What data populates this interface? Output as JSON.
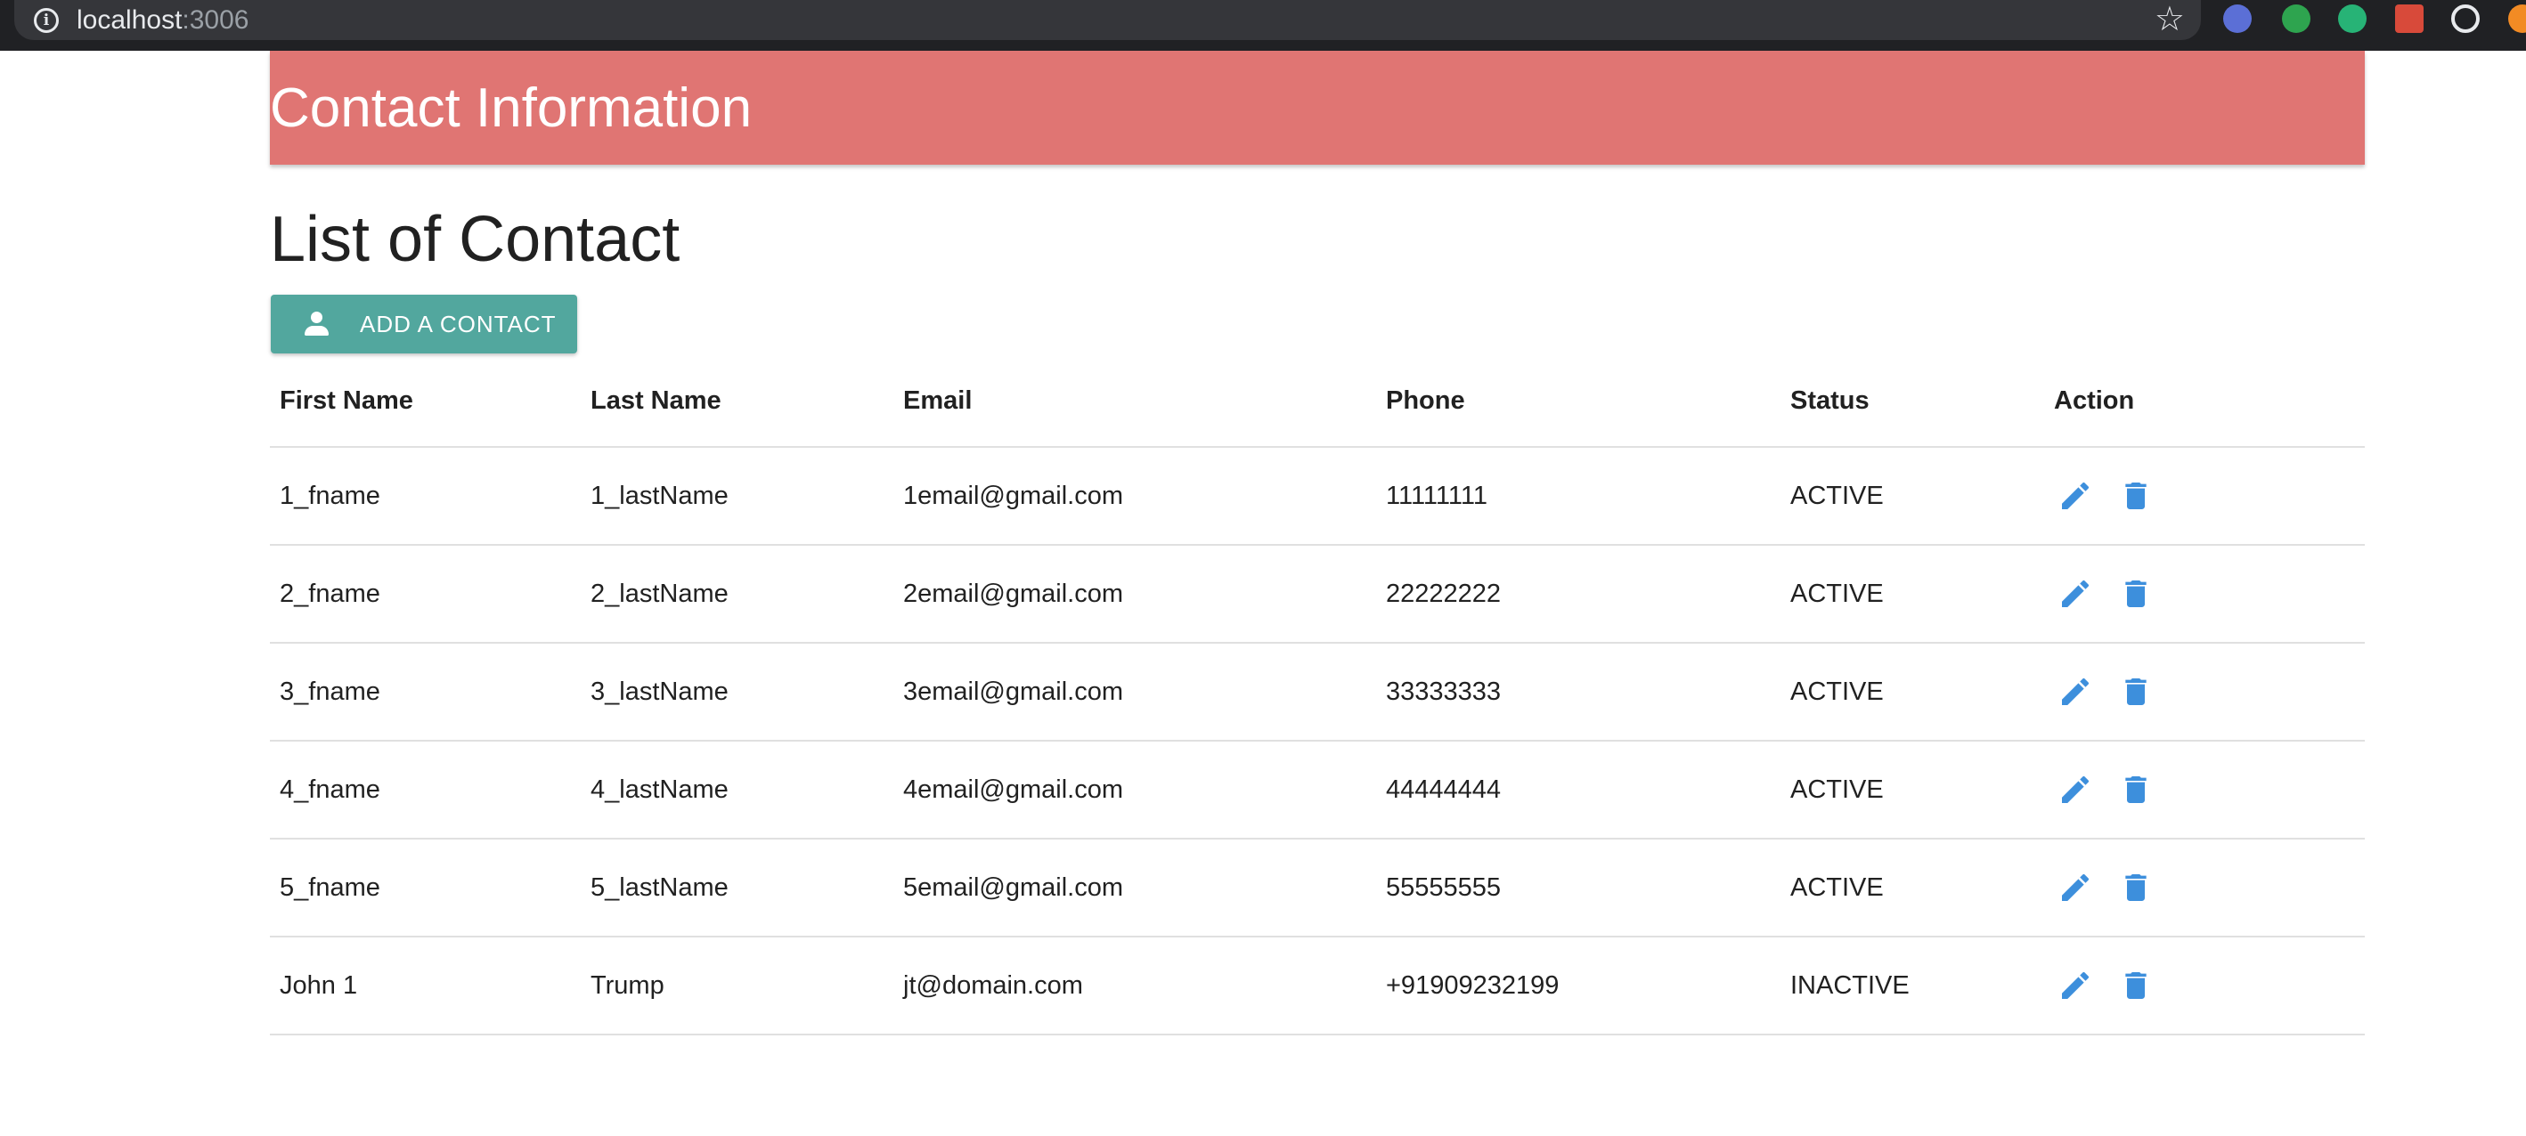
{
  "browser": {
    "url_host": "localhost",
    "url_port": ":3006",
    "extension_colors": [
      "#5b6fd6",
      "#2ea44f",
      "#27b376",
      "#d84a3a",
      "#e8eaed"
    ]
  },
  "header": {
    "title": "Contact Information",
    "color": "#e07573"
  },
  "page": {
    "title": "List of Contact"
  },
  "add_button": {
    "label": "ADD A CONTACT",
    "color": "#52a79e",
    "icon": "person-icon"
  },
  "table": {
    "columns": [
      "First Name",
      "Last Name",
      "Email",
      "Phone",
      "Status",
      "Action"
    ],
    "rows": [
      {
        "first": "1_fname",
        "last": "1_lastName",
        "email": "1email@gmail.com",
        "phone": "11111111",
        "status": "ACTIVE"
      },
      {
        "first": "2_fname",
        "last": "2_lastName",
        "email": "2email@gmail.com",
        "phone": "22222222",
        "status": "ACTIVE"
      },
      {
        "first": "3_fname",
        "last": "3_lastName",
        "email": "3email@gmail.com",
        "phone": "33333333",
        "status": "ACTIVE"
      },
      {
        "first": "4_fname",
        "last": "4_lastName",
        "email": "4email@gmail.com",
        "phone": "44444444",
        "status": "ACTIVE"
      },
      {
        "first": "5_fname",
        "last": "5_lastName",
        "email": "5email@gmail.com",
        "phone": "55555555",
        "status": "ACTIVE"
      },
      {
        "first": "John 1",
        "last": "Trump",
        "email": "jt@domain.com",
        "phone": "+91909232199",
        "status": "INACTIVE"
      }
    ],
    "action_icons": [
      "edit-icon",
      "delete-icon"
    ],
    "action_color": "#3d8fdc"
  }
}
